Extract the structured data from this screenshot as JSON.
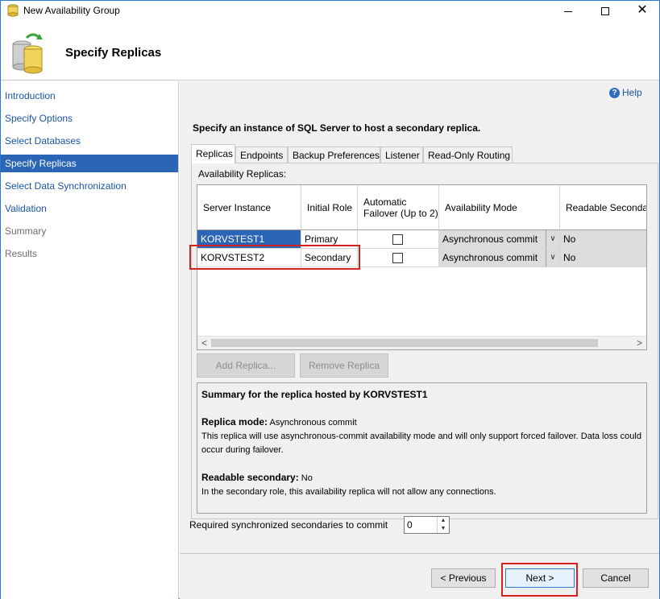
{
  "window": {
    "title": "New Availability Group",
    "minimize_glyph": "—",
    "maximize_glyph": "☐",
    "close_glyph": "✕"
  },
  "header": {
    "title": "Specify Replicas"
  },
  "nav": {
    "items": [
      {
        "label": "Introduction",
        "state": "link"
      },
      {
        "label": "Specify Options",
        "state": "link"
      },
      {
        "label": "Select Databases",
        "state": "link"
      },
      {
        "label": "Specify Replicas",
        "state": "selected"
      },
      {
        "label": "Select Data Synchronization",
        "state": "link"
      },
      {
        "label": "Validation",
        "state": "link"
      },
      {
        "label": "Summary",
        "state": "disabled"
      },
      {
        "label": "Results",
        "state": "disabled"
      }
    ]
  },
  "help": {
    "label": "Help",
    "glyph": "?"
  },
  "instruction": "Specify an instance of SQL Server to host a secondary replica.",
  "tabs": [
    "Replicas",
    "Endpoints",
    "Backup Preferences",
    "Listener",
    "Read-Only Routing"
  ],
  "replicas_panel": {
    "label": "Availability Replicas:",
    "columns": [
      "Server Instance",
      "Initial Role",
      "Automatic Failover (Up to 2)",
      "Availability Mode",
      "Readable Secondar"
    ],
    "rows": [
      {
        "server": "KORVSTEST1",
        "role": "Primary",
        "failover_checked": false,
        "mode": "Asynchronous commit",
        "readable": "No"
      },
      {
        "server": "KORVSTEST2",
        "role": "Secondary",
        "failover_checked": false,
        "mode": "Asynchronous commit",
        "readable": "No"
      }
    ],
    "scroll_left": "<",
    "scroll_right": ">",
    "dropdown_glyph": "∨",
    "add_replica_label": "Add Replica...",
    "remove_replica_label": "Remove Replica"
  },
  "summary": {
    "title": "Summary for the replica hosted by KORVSTEST1",
    "mode_label": "Replica mode:",
    "mode_value": "Asynchronous commit",
    "mode_desc_1": "This replica will use asynchronous-commit availability mode and will only support forced failover. Data loss could",
    "mode_desc_2": "occur during failover.",
    "readable_label": "Readable secondary:",
    "readable_value": "No",
    "readable_desc": "In the secondary role, this availability replica will not allow any connections."
  },
  "required_sync": {
    "label": "Required synchronized secondaries to commit",
    "value": "0",
    "up_glyph": "▲",
    "down_glyph": "▼"
  },
  "buttons": {
    "previous": "< Previous",
    "next": "Next >",
    "cancel": "Cancel"
  },
  "colors": {
    "selection": "#2b66b6",
    "link": "#1b55a6",
    "highlight_box": "#d62121"
  }
}
